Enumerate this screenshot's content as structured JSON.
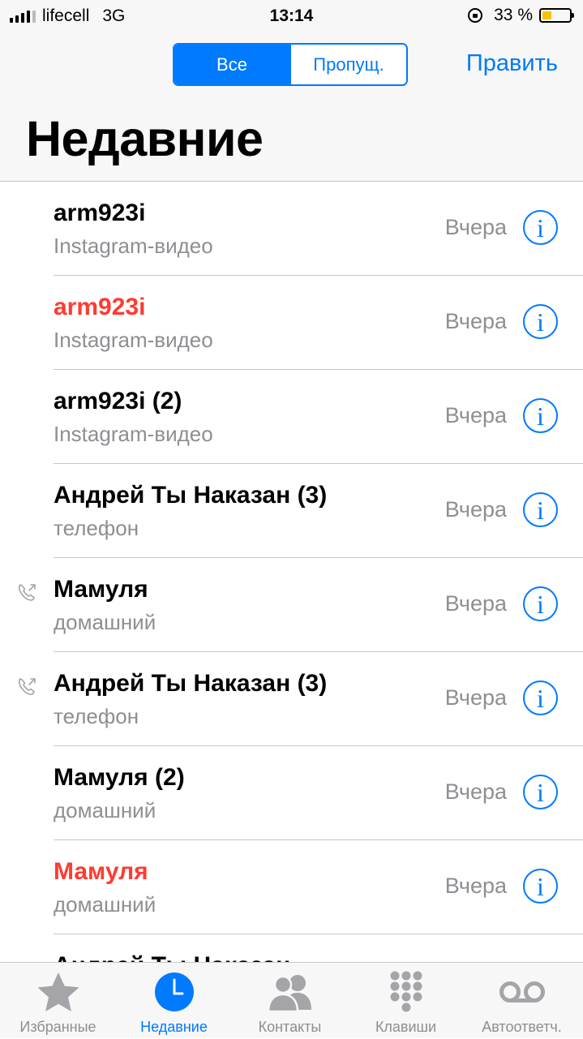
{
  "status_bar": {
    "carrier": "lifecell",
    "network": "3G",
    "time": "13:14",
    "battery_text": "33 %",
    "battery_level": 0.33,
    "battery_color": "#f5c400"
  },
  "header": {
    "segments": [
      "Все",
      "Пропущ."
    ],
    "selected_segment": "Все",
    "edit_label": "Править",
    "title": "Недавние"
  },
  "calls": [
    {
      "name": "arm923i",
      "type": "Instagram-видео",
      "date": "Вчера",
      "missed": false,
      "outgoing": false
    },
    {
      "name": "arm923i",
      "type": "Instagram-видео",
      "date": "Вчера",
      "missed": true,
      "outgoing": false
    },
    {
      "name": "arm923i (2)",
      "type": "Instagram-видео",
      "date": "Вчера",
      "missed": false,
      "outgoing": false
    },
    {
      "name": "Андрей Ты Наказан (3)",
      "type": "телефон",
      "date": "Вчера",
      "missed": false,
      "outgoing": false
    },
    {
      "name": "Мамуля",
      "type": "домашний",
      "date": "Вчера",
      "missed": false,
      "outgoing": true
    },
    {
      "name": "Андрей Ты Наказан (3)",
      "type": "телефон",
      "date": "Вчера",
      "missed": false,
      "outgoing": true
    },
    {
      "name": "Мамуля (2)",
      "type": "домашний",
      "date": "Вчера",
      "missed": false,
      "outgoing": false
    },
    {
      "name": "Мамуля",
      "type": "домашний",
      "date": "Вчера",
      "missed": true,
      "outgoing": false
    },
    {
      "name": "Андрей Ты Наказан",
      "type": "",
      "date": "",
      "missed": false,
      "outgoing": false
    }
  ],
  "tabs": [
    {
      "label": "Избранные",
      "icon": "star-icon",
      "active": false
    },
    {
      "label": "Недавние",
      "icon": "clock-icon",
      "active": true
    },
    {
      "label": "Контакты",
      "icon": "contacts-icon",
      "active": false
    },
    {
      "label": "Клавиши",
      "icon": "keypad-icon",
      "active": false
    },
    {
      "label": "Автоответч.",
      "icon": "voicemail-icon",
      "active": false
    }
  ],
  "colors": {
    "accent": "#007aff",
    "missed": "#ff3b30",
    "secondary_text": "#8e8e93",
    "inactive_icon": "#a4a4a9"
  }
}
